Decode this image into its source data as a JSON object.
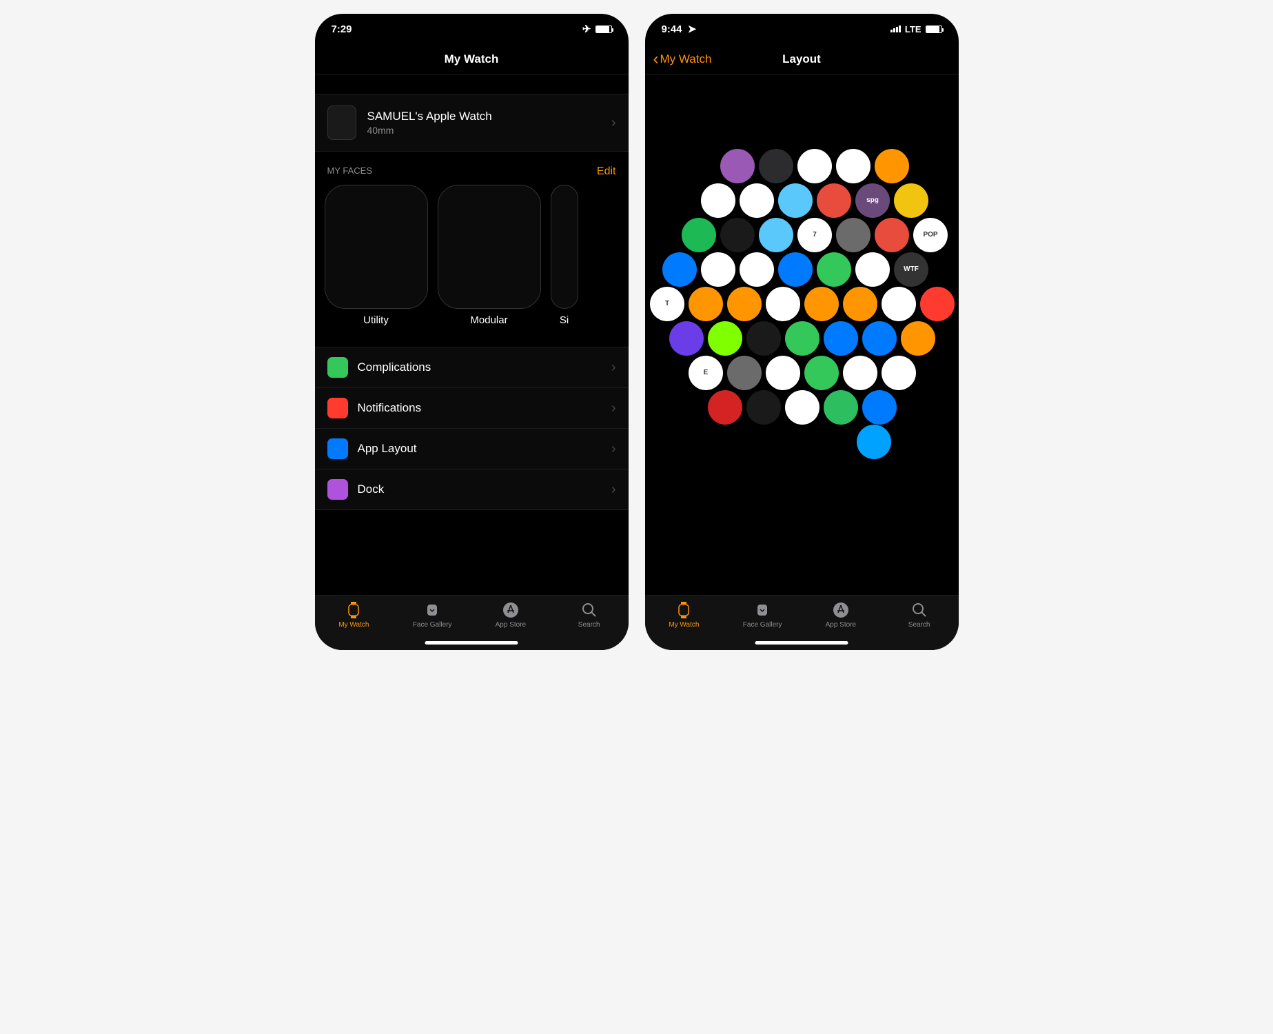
{
  "left": {
    "status": {
      "time": "7:29",
      "airplane": true
    },
    "header": {
      "title": "My Watch"
    },
    "watch": {
      "name": "SAMUEL's Apple Watch",
      "size": "40mm"
    },
    "faces_header": "MY FACES",
    "edit_label": "Edit",
    "faces": [
      {
        "label": "Utility"
      },
      {
        "label": "Modular"
      },
      {
        "label": "Si"
      }
    ],
    "menu": [
      {
        "label": "Complications",
        "icon_color": "#34c759"
      },
      {
        "label": "Notifications",
        "icon_color": "#ff3b30"
      },
      {
        "label": "App Layout",
        "icon_color": "#007aff"
      },
      {
        "label": "Dock",
        "icon_color": "#af52de"
      }
    ]
  },
  "right": {
    "status": {
      "time": "9:44",
      "location": true,
      "network": "LTE"
    },
    "header": {
      "back": "My Watch",
      "title": "Layout"
    },
    "apps": [
      {
        "name": "podcasts",
        "bg": "#9b59b6",
        "row": 0,
        "col": 0
      },
      {
        "name": "heart",
        "bg": "#2c2c2e",
        "row": 0,
        "col": 1
      },
      {
        "name": "breathe-alt",
        "bg": "#ffffff",
        "row": 0,
        "col": 2
      },
      {
        "name": "home",
        "bg": "#ffffff",
        "row": 0,
        "col": 3
      },
      {
        "name": "workout",
        "bg": "#ff9500",
        "row": 0,
        "col": 4
      },
      {
        "name": "ecg",
        "bg": "#ffffff",
        "row": 1,
        "col": 0
      },
      {
        "name": "breathe",
        "bg": "#ffffff",
        "row": 1,
        "col": 1
      },
      {
        "name": "mind",
        "bg": "#5ac8fa",
        "row": 1,
        "col": 2
      },
      {
        "name": "todoist",
        "bg": "#e74c3c",
        "row": 1,
        "col": 3
      },
      {
        "name": "spg",
        "bg": "#6a4a7a",
        "row": 1,
        "col": 4,
        "text": "spg"
      },
      {
        "name": "camera",
        "bg": "#f1c40f",
        "row": 1,
        "col": 5
      },
      {
        "name": "spotify",
        "bg": "#1db954",
        "row": 2,
        "col": 0
      },
      {
        "name": "findmy",
        "bg": "#1a1a1a",
        "row": 2,
        "col": 1
      },
      {
        "name": "weather",
        "bg": "#5ac8fa",
        "row": 2,
        "col": 2
      },
      {
        "name": "calendar",
        "bg": "#ffffff",
        "row": 2,
        "col": 3,
        "text": "7"
      },
      {
        "name": "contacts",
        "bg": "#6b6b6b",
        "row": 2,
        "col": 4
      },
      {
        "name": "things",
        "bg": "#e74c3c",
        "row": 2,
        "col": 5
      },
      {
        "name": "pop",
        "bg": "#ffffff",
        "row": 2,
        "col": 6,
        "text": "POP"
      },
      {
        "name": "authenticator",
        "bg": "#007aff",
        "row": 3,
        "col": 0
      },
      {
        "name": "maps",
        "bg": "#ffffff",
        "row": 3,
        "col": 1
      },
      {
        "name": "music",
        "bg": "#ffffff",
        "row": 3,
        "col": 2
      },
      {
        "name": "mail",
        "bg": "#007aff",
        "row": 3,
        "col": 3
      },
      {
        "name": "phone",
        "bg": "#34c759",
        "row": 3,
        "col": 4
      },
      {
        "name": "messenger",
        "bg": "#ffffff",
        "row": 3,
        "col": 5
      },
      {
        "name": "wtf",
        "bg": "#333",
        "row": 3,
        "col": 6,
        "text": "WTF"
      },
      {
        "name": "nytimes",
        "bg": "#ffffff",
        "row": 4,
        "col": 0,
        "text": "T"
      },
      {
        "name": "alarm",
        "bg": "#ff9500",
        "row": 4,
        "col": 1
      },
      {
        "name": "world-clock",
        "bg": "#ff9500",
        "row": 4,
        "col": 2
      },
      {
        "name": "clock",
        "bg": "#ffffff",
        "row": 4,
        "col": 3
      },
      {
        "name": "stopwatch",
        "bg": "#ff9500",
        "row": 4,
        "col": 4
      },
      {
        "name": "timer",
        "bg": "#ff9500",
        "row": 4,
        "col": 5
      },
      {
        "name": "news",
        "bg": "#ffffff",
        "row": 4,
        "col": 6
      },
      {
        "name": "radio-app",
        "bg": "#ff3b30",
        "row": 4,
        "col": 7
      },
      {
        "name": "remote",
        "bg": "#6a3de8",
        "row": 5,
        "col": 0
      },
      {
        "name": "workout2",
        "bg": "#7fff00",
        "row": 5,
        "col": 1
      },
      {
        "name": "activity",
        "bg": "#1a1a1a",
        "row": 5,
        "col": 2
      },
      {
        "name": "messages",
        "bg": "#34c759",
        "row": 5,
        "col": 3
      },
      {
        "name": "play",
        "bg": "#007aff",
        "row": 5,
        "col": 4
      },
      {
        "name": "keynote",
        "bg": "#007aff",
        "row": 5,
        "col": 5
      },
      {
        "name": "sun",
        "bg": "#ff9500",
        "row": 5,
        "col": 6
      },
      {
        "name": "espn",
        "bg": "#ffffff",
        "row": 6,
        "col": 0,
        "text": "E"
      },
      {
        "name": "settings",
        "bg": "#6b6b6b",
        "row": 6,
        "col": 1
      },
      {
        "name": "photos",
        "bg": "#ffffff",
        "row": 6,
        "col": 2
      },
      {
        "name": "radio",
        "bg": "#34c759",
        "row": 6,
        "col": 3
      },
      {
        "name": "appstore",
        "bg": "#ffffff",
        "row": 6,
        "col": 4
      },
      {
        "name": "grid-app",
        "bg": "#ffffff",
        "row": 6,
        "col": 5
      },
      {
        "name": "yelp",
        "bg": "#d32323",
        "row": 7,
        "col": 0
      },
      {
        "name": "stocks",
        "bg": "#1a1a1a",
        "row": 7,
        "col": 1
      },
      {
        "name": "health",
        "bg": "#ffffff",
        "row": 7,
        "col": 2
      },
      {
        "name": "evernote",
        "bg": "#2dbe60",
        "row": 7,
        "col": 3
      },
      {
        "name": "files",
        "bg": "#007aff",
        "row": 7,
        "col": 4
      },
      {
        "name": "home2",
        "bg": "#00a2ff",
        "row": 8,
        "col": 0
      }
    ]
  },
  "tabs": [
    {
      "label": "My Watch",
      "icon": "watch"
    },
    {
      "label": "Face Gallery",
      "icon": "gallery"
    },
    {
      "label": "App Store",
      "icon": "store"
    },
    {
      "label": "Search",
      "icon": "search"
    }
  ]
}
